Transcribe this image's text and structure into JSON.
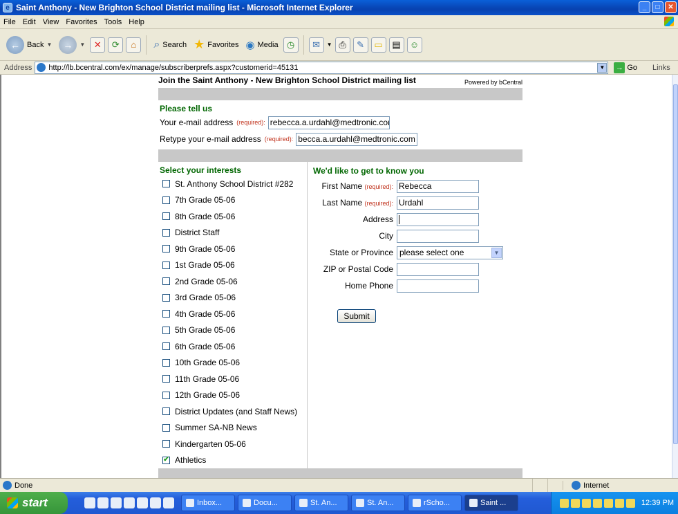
{
  "window": {
    "title": "Saint Anthony - New Brighton School District mailing list - Microsoft Internet Explorer"
  },
  "menu": [
    "File",
    "Edit",
    "View",
    "Favorites",
    "Tools",
    "Help"
  ],
  "toolbar": {
    "back": "Back",
    "search": "Search",
    "favorites": "Favorites",
    "media": "Media"
  },
  "address": {
    "label": "Address",
    "url": "http://lb.bcentral.com/ex/manage/subscriberprefs.aspx?customerid=45131",
    "go": "Go",
    "links": "Links"
  },
  "page": {
    "heading": "Join the Saint Anthony - New Brighton School District mailing list",
    "powered_by": "Powered by bCentral",
    "tell_us": "Please tell us",
    "email_label": "Your e-mail address",
    "retype_label": "Retype your e-mail address",
    "required": "(required):",
    "email_value": "rebecca.a.urdahl@medtronic.cor",
    "retype_value": "becca.a.urdahl@medtronic.com",
    "interests_title": "Select your interests",
    "know_title": "We'd like to get to know you",
    "interests": [
      {
        "label": "St. Anthony School District #282",
        "checked": false
      },
      {
        "label": "7th Grade 05-06",
        "checked": false
      },
      {
        "label": "8th Grade 05-06",
        "checked": false
      },
      {
        "label": "District Staff",
        "checked": false
      },
      {
        "label": "9th Grade 05-06",
        "checked": false
      },
      {
        "label": "1st Grade 05-06",
        "checked": false
      },
      {
        "label": "2nd Grade 05-06",
        "checked": false
      },
      {
        "label": "3rd Grade 05-06",
        "checked": false
      },
      {
        "label": "4th Grade 05-06",
        "checked": false
      },
      {
        "label": "5th Grade 05-06",
        "checked": false
      },
      {
        "label": "6th Grade 05-06",
        "checked": false
      },
      {
        "label": "10th Grade 05-06",
        "checked": false
      },
      {
        "label": "11th Grade 05-06",
        "checked": false
      },
      {
        "label": "12th Grade 05-06",
        "checked": false
      },
      {
        "label": "District Updates (and Staff News)",
        "checked": false
      },
      {
        "label": "Summer SA-NB News",
        "checked": false
      },
      {
        "label": "Kindergarten 05-06",
        "checked": false
      },
      {
        "label": "Athletics",
        "checked": true
      }
    ],
    "fields": {
      "first_name": {
        "label": "First Name",
        "value": "Rebecca"
      },
      "last_name": {
        "label": "Last Name",
        "value": "Urdahl"
      },
      "address": {
        "label": "Address",
        "value": ""
      },
      "city": {
        "label": "City",
        "value": ""
      },
      "state": {
        "label": "State or Province",
        "value": "please select one"
      },
      "zip": {
        "label": "ZIP or Postal Code",
        "value": ""
      },
      "phone": {
        "label": "Home Phone",
        "value": ""
      }
    },
    "submit": "Submit"
  },
  "status": {
    "text": "Done",
    "zone": "Internet"
  },
  "taskbar": {
    "start": "start",
    "tasks": [
      "Inbox...",
      "Docu...",
      "St. An...",
      "St. An...",
      "rScho...",
      "Saint ..."
    ],
    "clock": "12:39 PM"
  },
  "colors": {
    "green_heading": "#006600",
    "required_red": "#c0311b",
    "band_gray": "#c8c8c8"
  }
}
